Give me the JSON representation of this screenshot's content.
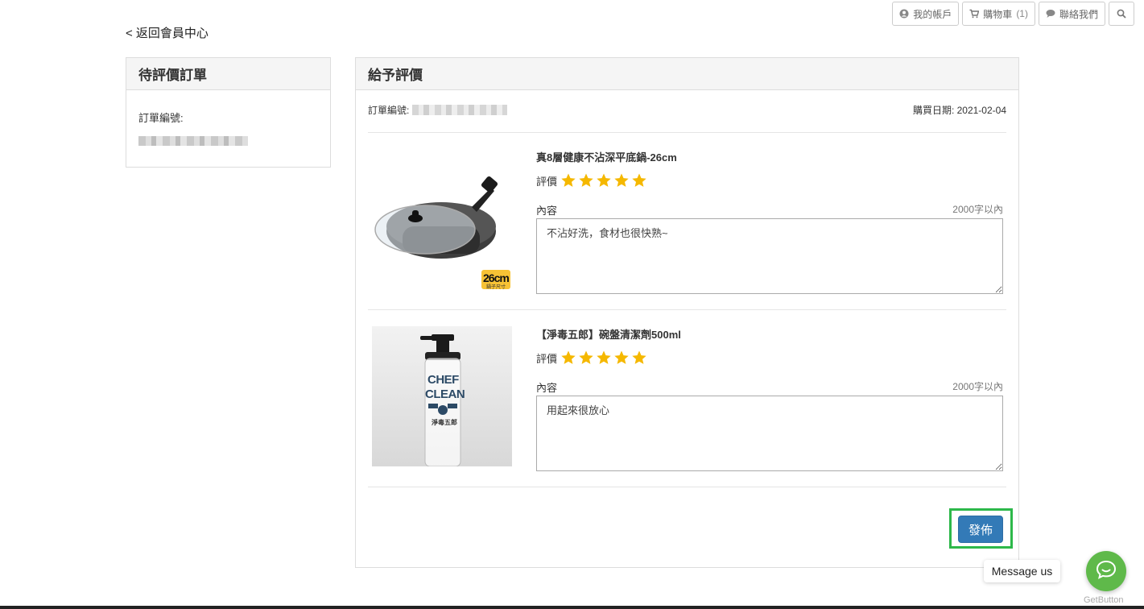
{
  "topbar": {
    "account": {
      "label": "我的帳戶",
      "icon": "user-circle-icon"
    },
    "cart": {
      "label": "購物車",
      "count": "(1)",
      "icon": "cart-icon"
    },
    "contact": {
      "label": "聯絡我們",
      "icon": "chat-bubble-icon"
    },
    "search": {
      "icon": "search-icon"
    }
  },
  "back_link": "< 返回會員中心",
  "left_panel": {
    "title": "待評價訂單",
    "order_no_label": "訂單編號:"
  },
  "right_panel": {
    "title": "給予評價",
    "order_no_label": "訂單編號:",
    "purchase_date": "購買日期: 2021-02-04",
    "items": [
      {
        "title": "真8層健康不沾深平底鍋-26cm",
        "rating_label": "評價",
        "rating": 5,
        "rating_max": 5,
        "content_label": "內容",
        "limit": "2000字以內",
        "review": "不沾好洗，食材也很快熟~",
        "image_badge": "26cm",
        "image_badge_sub": "鍋子尺寸"
      },
      {
        "title": "【淨毒五郎】碗盤清潔劑500ml",
        "rating_label": "評價",
        "rating": 5,
        "rating_max": 5,
        "content_label": "內容",
        "limit": "2000字以內",
        "review": "用起來很放心",
        "bottle_line1": "CHEF",
        "bottle_line2": "CLEAN",
        "bottle_brand": "淨毒五郎"
      }
    ],
    "publish_label": "發佈"
  },
  "chat_widget": {
    "tooltip": "Message us",
    "brand": "GetButton"
  },
  "colors": {
    "primary_button": "#337ab7",
    "highlight_frame": "#2db84a",
    "star": "#f5b800",
    "chat_button": "#5fb94a"
  }
}
